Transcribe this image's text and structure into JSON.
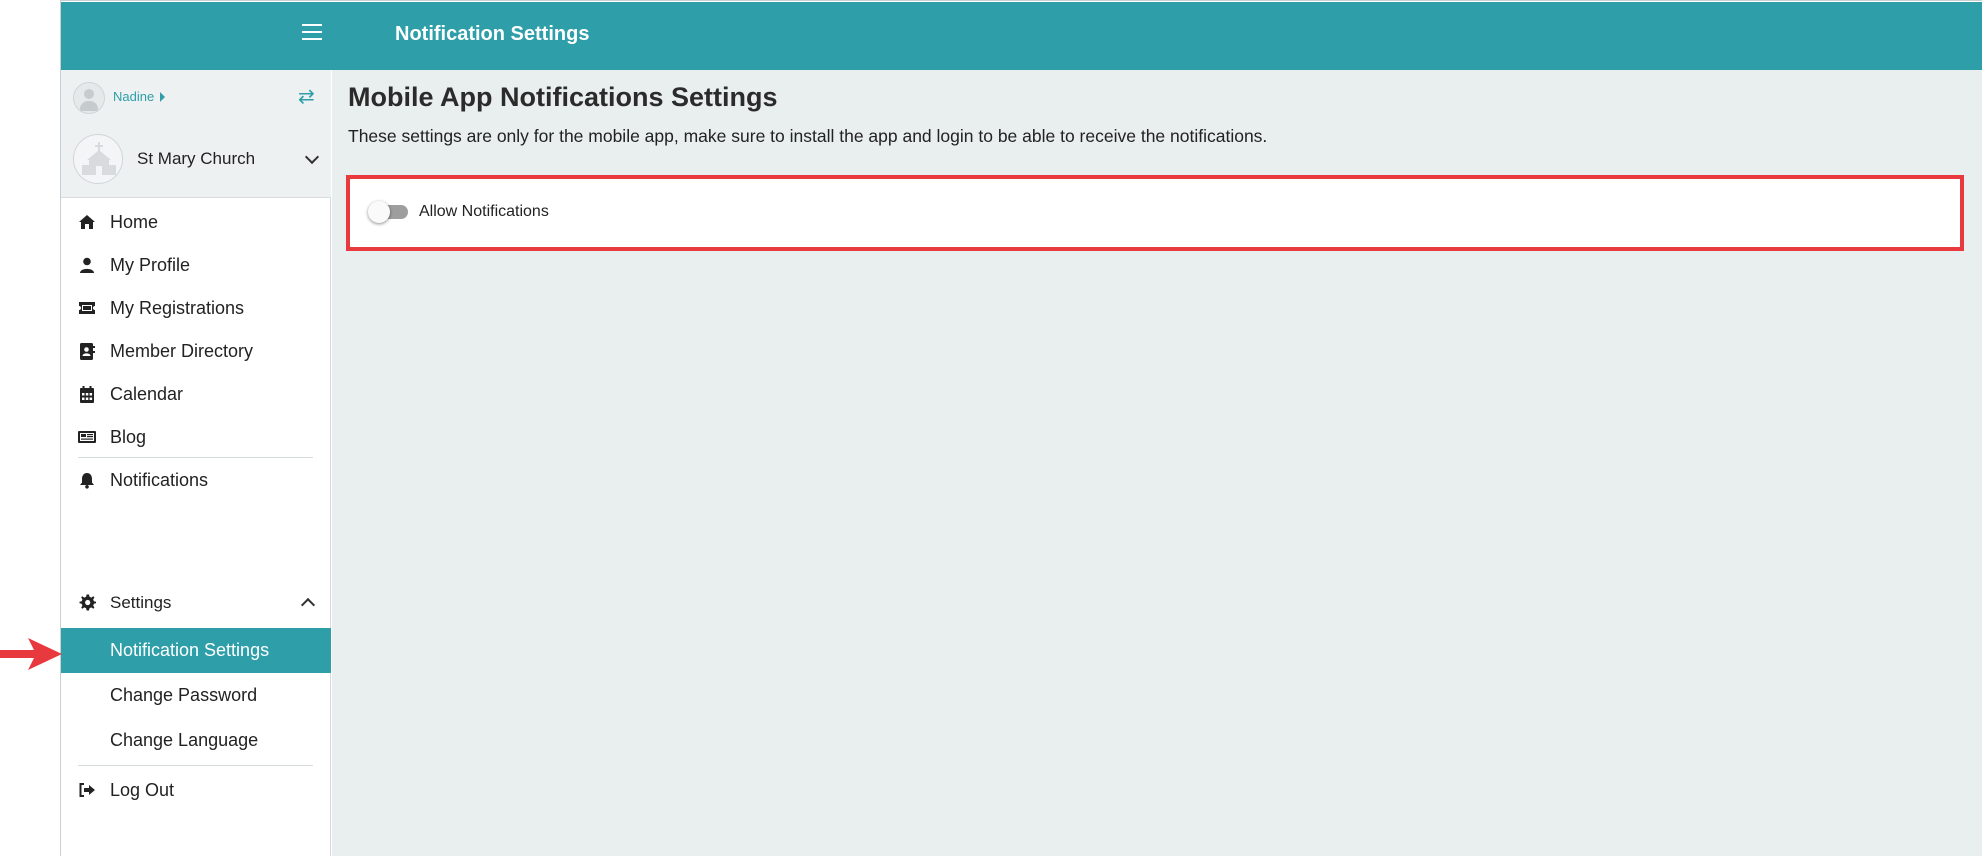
{
  "header": {
    "title": "Notification Settings",
    "menu_icon": "hamburger-menu-icon"
  },
  "user": {
    "name": "Nadine",
    "switch_icon": "swap-arrows-icon"
  },
  "church": {
    "name": "St Mary Church"
  },
  "nav": {
    "items": [
      {
        "label": "Home",
        "icon": "home-icon"
      },
      {
        "label": "My Profile",
        "icon": "user-icon"
      },
      {
        "label": "My Registrations",
        "icon": "ticket-icon"
      },
      {
        "label": "Member Directory",
        "icon": "address-book-icon"
      },
      {
        "label": "Calendar",
        "icon": "calendar-icon"
      },
      {
        "label": "Blog",
        "icon": "newspaper-icon"
      },
      {
        "label": "Notifications",
        "icon": "bell-icon"
      },
      {
        "label": "Settings",
        "icon": "gear-icon"
      }
    ],
    "settings_sub": [
      {
        "label": "Notification Settings",
        "active": true
      },
      {
        "label": "Change Password",
        "active": false
      },
      {
        "label": "Change Language",
        "active": false
      }
    ],
    "logout": {
      "label": "Log Out",
      "icon": "sign-out-icon"
    }
  },
  "main": {
    "title": "Mobile App Notifications Settings",
    "description": "These settings are only for the mobile app, make sure to install the app and login to be able to receive the notifications.",
    "toggle": {
      "label": "Allow Notifications",
      "checked": false
    }
  },
  "colors": {
    "accent": "#2e9ea8",
    "highlight": "#e8393e",
    "background": "#e9eeef"
  }
}
